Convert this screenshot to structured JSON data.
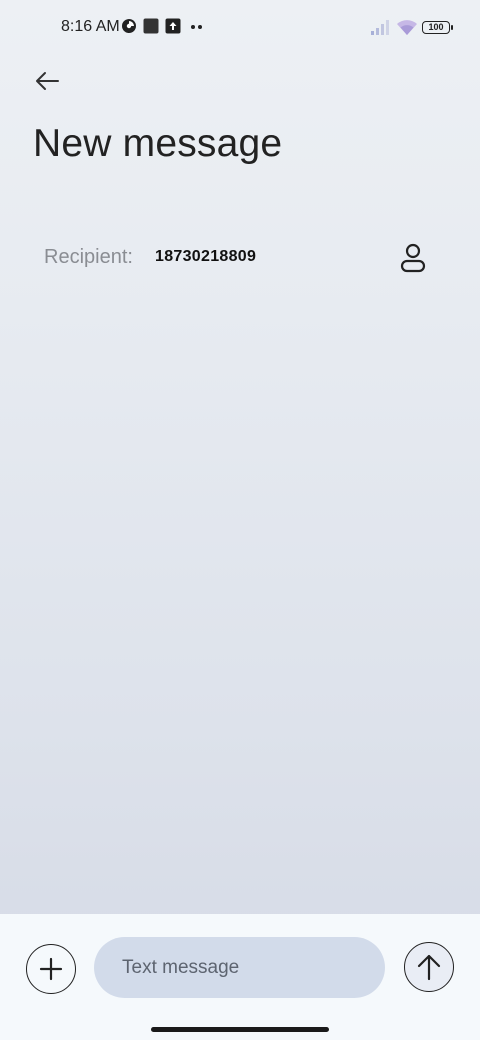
{
  "status_bar": {
    "time": "8:16 AM",
    "battery": "100",
    "icons": [
      "data-saver-icon",
      "square-app-icon",
      "upload-icon",
      "more-dots-icon",
      "signal-icon",
      "wifi-icon",
      "battery-icon"
    ]
  },
  "header": {
    "title": "New message"
  },
  "recipient": {
    "label": "Recipient:",
    "value": "18730218809"
  },
  "composer": {
    "placeholder": "Text message"
  }
}
